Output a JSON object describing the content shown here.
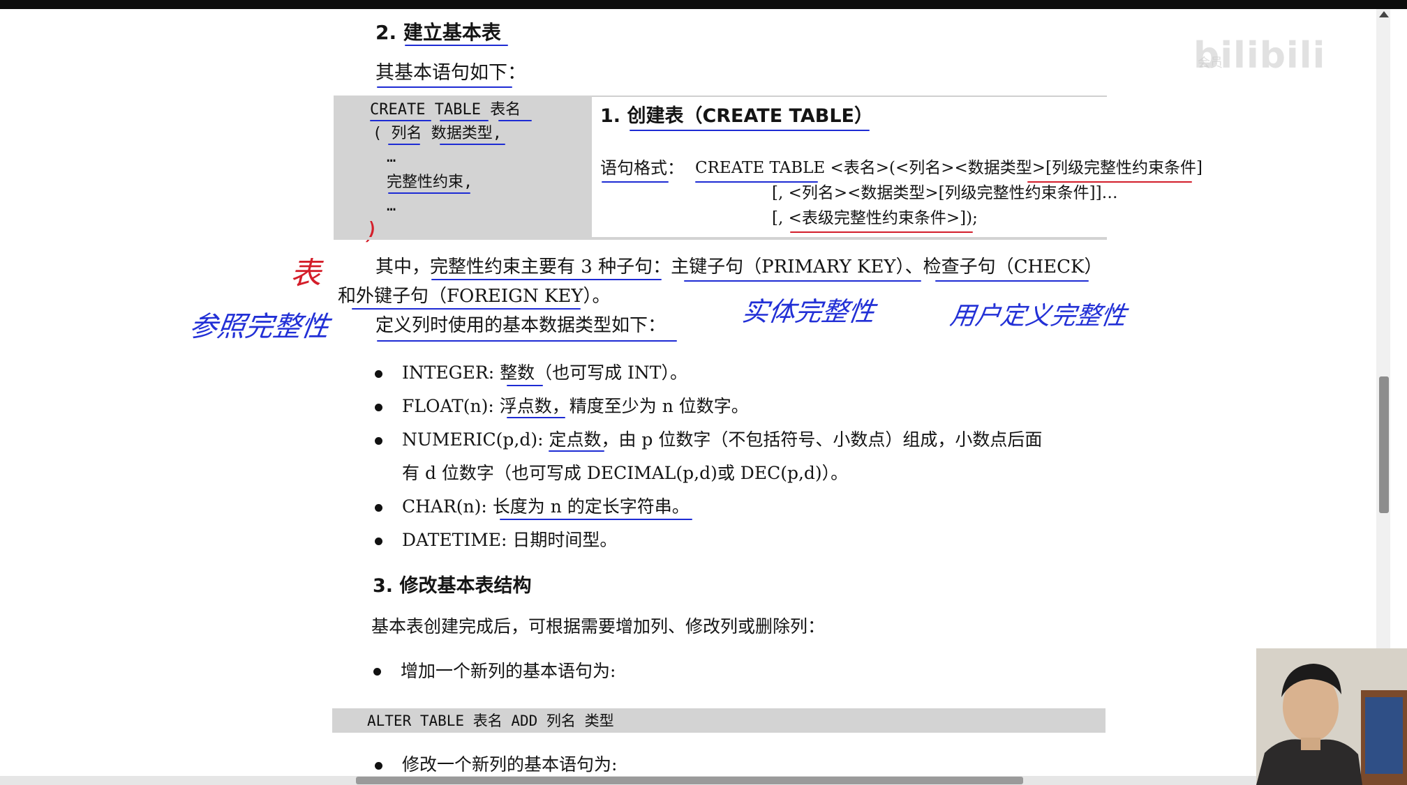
{
  "section2": {
    "heading": "2.  建立基本表",
    "intro": "其基本语句如下："
  },
  "code_box": {
    "line1": "CREATE  TABLE  表名",
    "line2": "(  列名    数据类型,",
    "line3": "…",
    "line4": "完整性约束,",
    "line5": "…",
    "line6": ")"
  },
  "create_table": {
    "heading": "1.  创建表（CREATE TABLE）",
    "format_label": "语句格式：",
    "format_line1": "CREATE TABLE <表名>(<列名><数据类型>[列级完整性约束条件]",
    "format_line2": "[, <列名><数据类型>[列级完整性约束条件]]…",
    "format_line3": "[, <表级完整性约束条件>]);"
  },
  "constraints": {
    "line1": "其中，完整性约束主要有 3 种子句：主键子句（PRIMARY KEY）、检查子句（CHECK）",
    "line2": "和外键子句（FOREIGN KEY）。"
  },
  "datatypes_intro": "定义列时使用的基本数据类型如下：",
  "datatypes": [
    {
      "line1": "INTEGER:  整数（也可写成 INT）。"
    },
    {
      "line1": "FLOAT(n):  浮点数，精度至少为 n 位数字。"
    },
    {
      "line1": "NUMERIC(p,d):  定点数，由 p 位数字（不包括符号、小数点）组成，小数点后面",
      "line2": "有 d 位数字（也可写成 DECIMAL(p,d)或 DEC(p,d)）。"
    },
    {
      "line1": "CHAR(n):  长度为 n 的定长字符串。"
    },
    {
      "line1": "DATETIME:  日期时间型。"
    }
  ],
  "section3": {
    "heading": "3.  修改基本表结构",
    "intro": "基本表创建完成后，可根据需要增加列、修改列或删除列：",
    "add_column": "增加一个新列的基本语句为:",
    "alter_code": "ALTER  TABLE  表名  ADD  列名  类型",
    "modify_column": "修改一个新列的基本语句为:"
  },
  "annotations": {
    "biao": "表",
    "referential": "参照完整性",
    "entity": "实体完整性",
    "user_defined": "用户定义完整性"
  },
  "watermark": {
    "logo": "bilibili",
    "small": "会员"
  },
  "colors": {
    "ink_blue": "#1d2bd4",
    "ink_red": "#d21d2a",
    "code_bg": "#d3d3d3"
  }
}
